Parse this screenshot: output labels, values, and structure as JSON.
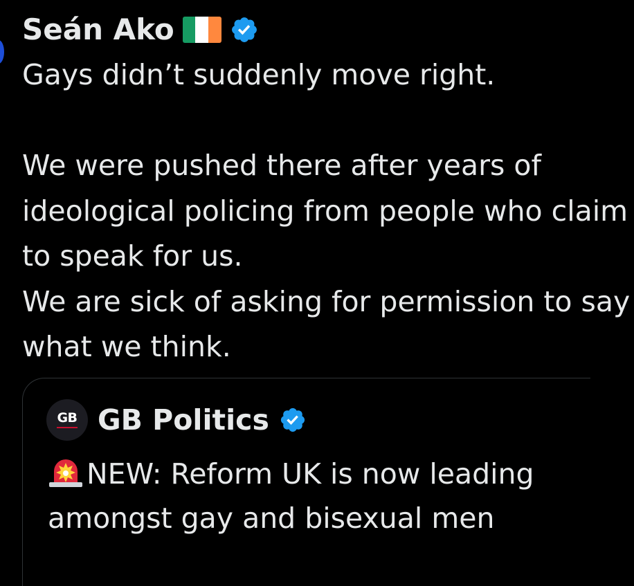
{
  "tweet": {
    "author_name": "Seán Ako",
    "flag": "ireland-flag",
    "verified": true,
    "text": "Gays didn’t suddenly move right.\n\nWe were pushed there after years of ideological policing from people who claim to speak for us.\nWe are sick of asking for permission to say what we think."
  },
  "quote": {
    "avatar_text": "GB",
    "author_name": "GB Politics",
    "verified": true,
    "emoji": "rotating-light-icon",
    "text": "NEW: Reform UK is now leading amongst gay and bisexual men"
  },
  "colors": {
    "background": "#000000",
    "text": "#e7e9ea",
    "verified_blue": "#1d9bf0",
    "border": "#2f3336",
    "flag_green": "#169b62",
    "flag_white": "#ffffff",
    "flag_orange": "#ff883e",
    "siren_red": "#e0283c"
  }
}
